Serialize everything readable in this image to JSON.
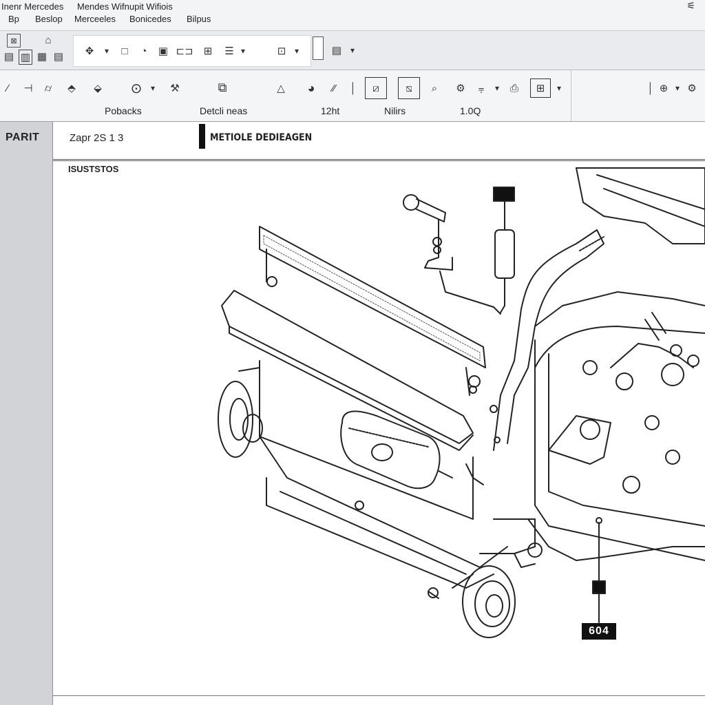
{
  "window": {
    "title": "Inenr Mercedes",
    "app_name": "Mendes Wifnupit Wifiois",
    "control_glyph": "⚟"
  },
  "menu": [
    "Bp",
    "Beslop",
    "Merceeles",
    "Bonicedes",
    "Bilpus"
  ],
  "toolbar": {
    "labels": [
      "Pobacks",
      "Detcli neas",
      "12ht",
      "Nilirs",
      "1.0Q"
    ]
  },
  "sidebar": {
    "label": "PARIT"
  },
  "info": {
    "part_text": "Zapr 2S 1   3",
    "section_title": "METIOLE DEDIEAGEN"
  },
  "diagram": {
    "section_label": "ISUSTSTOS",
    "callout_label": "604"
  },
  "icons": [
    "grid-icon",
    "list-icon",
    "select-icon",
    "square-icon",
    "gauge-icon",
    "wrench-icon",
    "plug-icon",
    "dropdown-arrow-icon",
    "zoom-icon",
    "search-icon"
  ]
}
